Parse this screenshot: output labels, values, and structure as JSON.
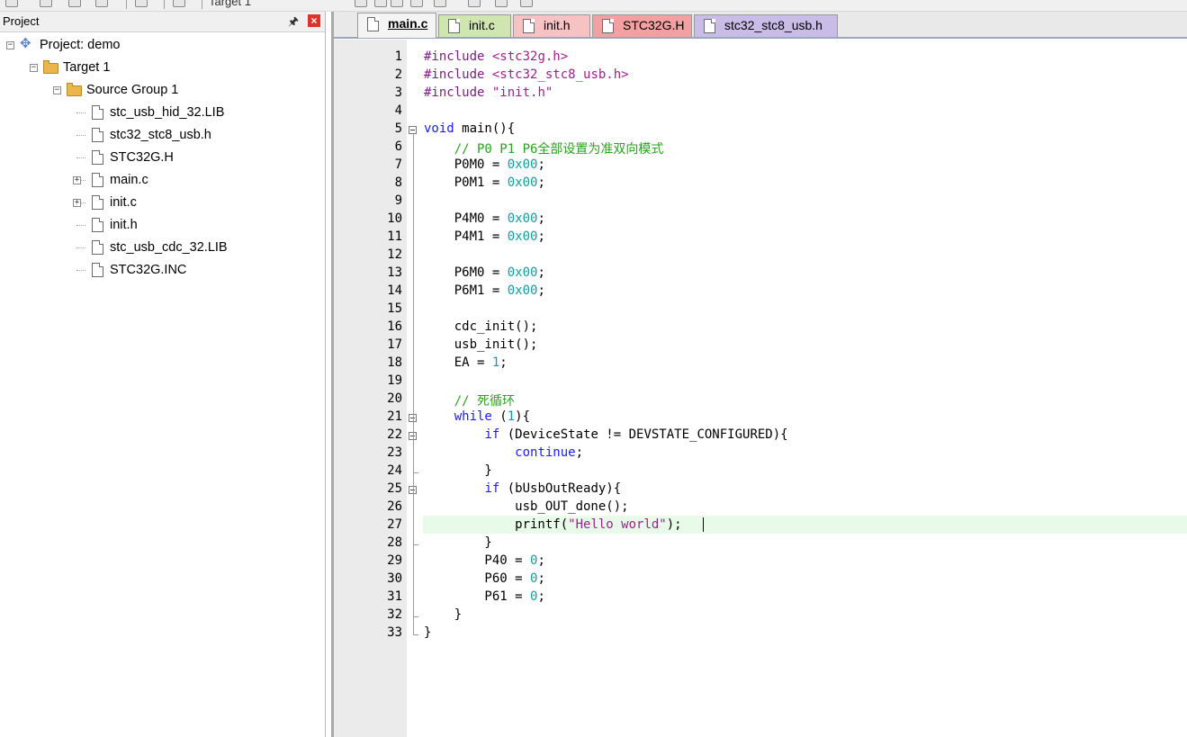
{
  "toolbar": {
    "target_select": "Target 1"
  },
  "project_panel": {
    "title": "Project",
    "tree": [
      {
        "label": "Project: demo",
        "kind": "project",
        "expander": "−"
      },
      {
        "label": "Target 1",
        "kind": "target",
        "expander": "−"
      },
      {
        "label": "Source Group 1",
        "kind": "folder",
        "expander": "−"
      },
      {
        "label": "stc_usb_hid_32.LIB",
        "kind": "file"
      },
      {
        "label": "stc32_stc8_usb.h",
        "kind": "file"
      },
      {
        "label": "STC32G.H",
        "kind": "file"
      },
      {
        "label": "main.c",
        "kind": "file",
        "expander": "+"
      },
      {
        "label": "init.c",
        "kind": "file",
        "expander": "+"
      },
      {
        "label": "init.h",
        "kind": "file"
      },
      {
        "label": "stc_usb_cdc_32.LIB",
        "kind": "file"
      },
      {
        "label": "STC32G.INC",
        "kind": "file"
      }
    ]
  },
  "editor": {
    "tabs": [
      {
        "label": "main.c",
        "active": true,
        "color": "#f4f4f4"
      },
      {
        "label": "init.c",
        "active": false,
        "color": "#cfe6b0"
      },
      {
        "label": "init.h",
        "active": false,
        "color": "#f7c2c4"
      },
      {
        "label": "STC32G.H",
        "active": false,
        "color": "#f2a0a1"
      },
      {
        "label": "stc32_stc8_usb.h",
        "active": false,
        "color": "#c9bde8"
      }
    ],
    "current_line": 27,
    "lines": [
      "#include <stc32g.h>",
      "#include <stc32_stc8_usb.h>",
      "#include \"init.h\"",
      "",
      "void main(){",
      "    // P0 P1 P6全部设置为准双向模式",
      "    P0M0 = 0x00;",
      "    P0M1 = 0x00;",
      "",
      "    P4M0 = 0x00;",
      "    P4M1 = 0x00;",
      "",
      "    P6M0 = 0x00;",
      "    P6M1 = 0x00;",
      "",
      "    cdc_init();",
      "    usb_init();",
      "    EA = 1;",
      "",
      "    // 死循环",
      "    while (1){",
      "        if (DeviceState != DEVSTATE_CONFIGURED){",
      "            continue;",
      "        }",
      "        if (bUsbOutReady){",
      "            usb_OUT_done();",
      "            printf(\"Hello world\");",
      "        }",
      "        P40 = 0;",
      "        P60 = 0;",
      "        P61 = 0;",
      "    }",
      "}"
    ]
  }
}
